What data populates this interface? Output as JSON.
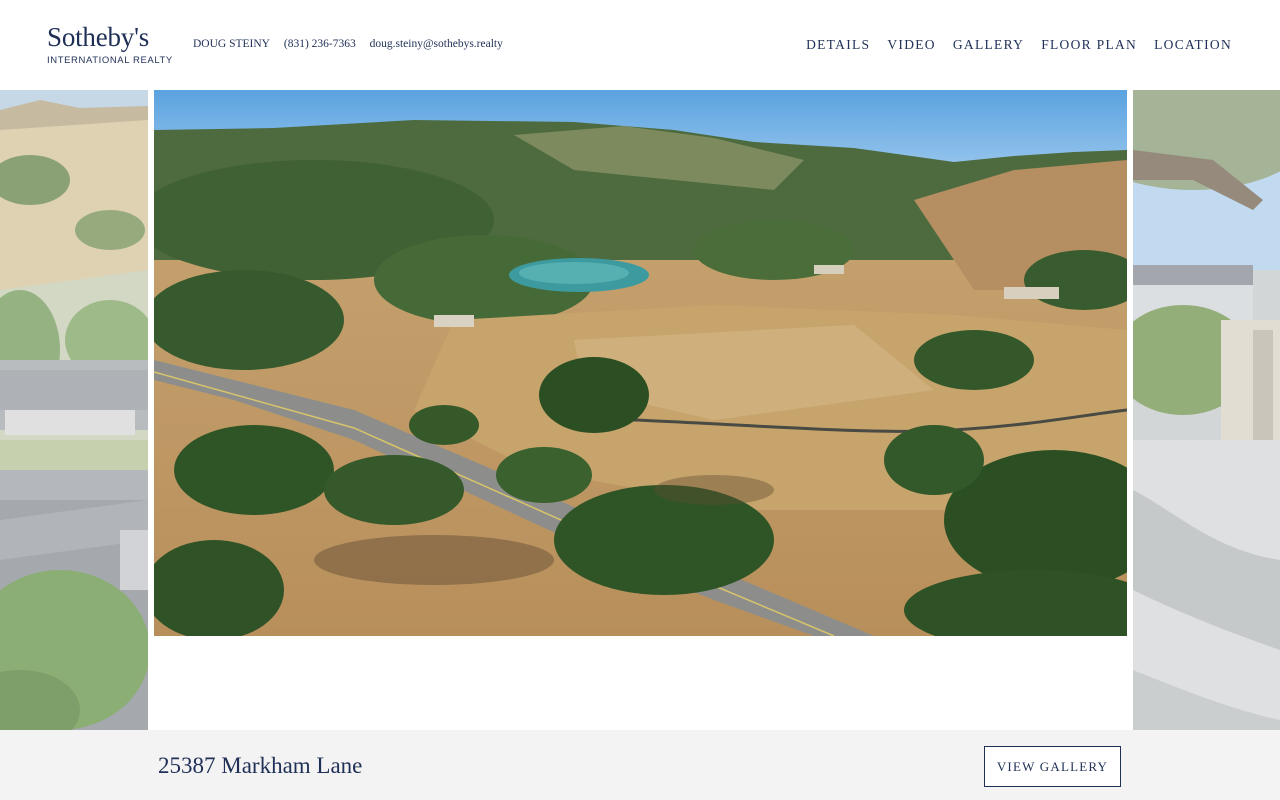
{
  "brand": {
    "name": "Sotheby's",
    "subtitle": "INTERNATIONAL REALTY"
  },
  "agent": {
    "name": "DOUG STEINY",
    "phone": "(831) 236-7363",
    "email": "doug.steiny@sothebys.realty"
  },
  "nav": {
    "items": [
      {
        "label": "DETAILS"
      },
      {
        "label": "VIDEO"
      },
      {
        "label": "GALLERY"
      },
      {
        "label": "FLOOR PLAN"
      },
      {
        "label": "LOCATION"
      }
    ]
  },
  "listing": {
    "address": "25387 Markham Lane",
    "view_gallery_label": "VIEW GALLERY"
  },
  "colors": {
    "brand_navy": "#1f2f56",
    "footer_bg": "#f3f3f3"
  }
}
